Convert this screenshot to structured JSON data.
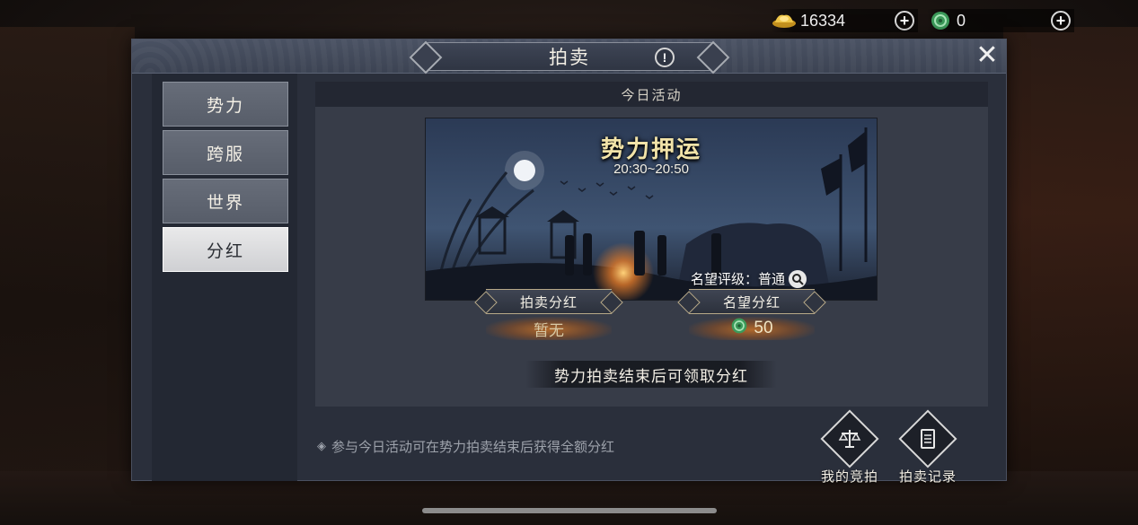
{
  "currency": {
    "gold": {
      "icon": "gold-ingot-icon",
      "value": "16334"
    },
    "jade": {
      "icon": "jade-coin-icon",
      "value": "0"
    }
  },
  "panel": {
    "title": "拍卖",
    "close_icon": "close-icon",
    "info_icon": "info-icon"
  },
  "tabs": [
    {
      "label": "势力",
      "active": false
    },
    {
      "label": "跨服",
      "active": false
    },
    {
      "label": "世界",
      "active": false
    },
    {
      "label": "分红",
      "active": true
    }
  ],
  "content": {
    "header": "今日活动",
    "event": {
      "title": "势力押运",
      "time": "20:30~20:50",
      "rank": "名望评级：普通"
    },
    "rewards": {
      "auction_label": "拍卖分红",
      "auction_value": "暂无",
      "fame_label": "名望分红",
      "fame_value": "50"
    },
    "notice": "势力拍卖结束后可领取分红"
  },
  "footer": {
    "tip": "参与今日活动可在势力拍卖结束后获得全额分红",
    "my_bid_label": "我的竞拍",
    "record_label": "拍卖记录"
  }
}
